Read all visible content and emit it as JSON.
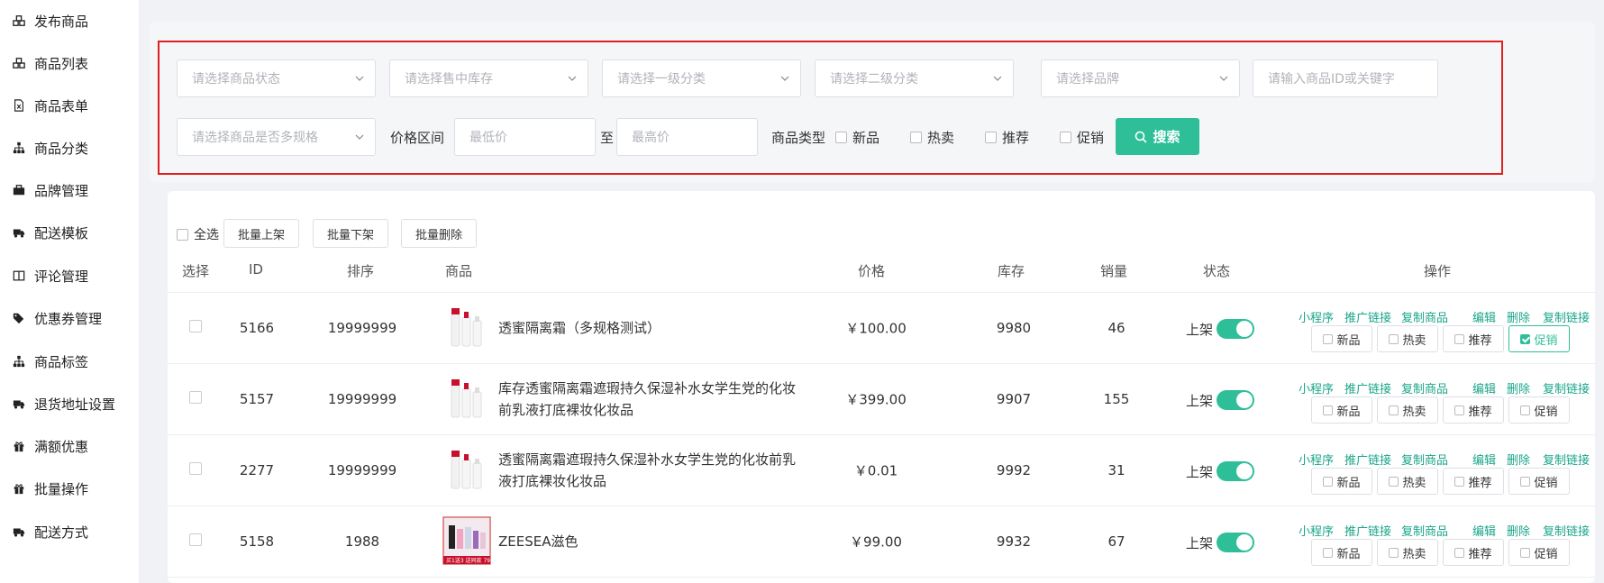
{
  "sidebar": {
    "items": [
      {
        "label": "发布商品",
        "icon": "cubes-icon"
      },
      {
        "label": "商品列表",
        "icon": "cubes-icon"
      },
      {
        "label": "商品表单",
        "icon": "excel-file-icon"
      },
      {
        "label": "商品分类",
        "icon": "sitemap-icon"
      },
      {
        "label": "品牌管理",
        "icon": "briefcase-icon"
      },
      {
        "label": "配送模板",
        "icon": "truck-icon"
      },
      {
        "label": "评论管理",
        "icon": "columns-icon"
      },
      {
        "label": "优惠券管理",
        "icon": "tags-icon"
      },
      {
        "label": "商品标签",
        "icon": "sitemap-icon"
      },
      {
        "label": "退货地址设置",
        "icon": "truck-icon"
      },
      {
        "label": "满额优惠",
        "icon": "gift-icon"
      },
      {
        "label": "批量操作",
        "icon": "gift-icon"
      },
      {
        "label": "配送方式",
        "icon": "truck-icon"
      }
    ]
  },
  "filters": {
    "status_placeholder": "请选择商品状态",
    "stock_placeholder": "请选择售中库存",
    "cat1_placeholder": "请选择一级分类",
    "cat2_placeholder": "请选择二级分类",
    "brand_placeholder": "请选择品牌",
    "keyword_placeholder": "请输入商品ID或关键字",
    "spec_placeholder": "请选择商品是否多规格",
    "price_label": "价格区间",
    "min_price_placeholder": "最低价",
    "to_label": "至",
    "max_price_placeholder": "最高价",
    "type_label": "商品类型",
    "types": [
      "新品",
      "热卖",
      "推荐",
      "促销"
    ],
    "search_label": "搜索"
  },
  "bulk": {
    "select_all": "全选",
    "on_shelf": "批量上架",
    "off_shelf": "批量下架",
    "delete": "批量删除"
  },
  "table": {
    "headers": {
      "select": "选择",
      "id": "ID",
      "sort": "排序",
      "product": "商品",
      "price": "价格",
      "stock": "库存",
      "sales": "销量",
      "status": "状态",
      "ops": "操作"
    },
    "rows": [
      {
        "id": "5166",
        "sort": "19999999",
        "name": "透蜜隔离霜（多规格测试）",
        "price": "￥100.00",
        "stock": "9980",
        "sales": "46",
        "status": "上架",
        "promo_on": true
      },
      {
        "id": "5157",
        "sort": "19999999",
        "name": "库存透蜜隔离霜遮瑕持久保湿补水女学生党的化妆前乳液打底裸妆化妆品",
        "price": "￥399.00",
        "stock": "9907",
        "sales": "155",
        "status": "上架",
        "promo_on": false
      },
      {
        "id": "2277",
        "sort": "19999999",
        "name": "透蜜隔离霜遮瑕持久保湿补水女学生党的化妆前乳液打底裸妆化妆品",
        "price": "￥0.01",
        "stock": "9992",
        "sales": "31",
        "status": "上架",
        "promo_on": false
      },
      {
        "id": "5158",
        "sort": "1988",
        "name": "ZEESEA滋色",
        "price": "￥99.00",
        "stock": "9932",
        "sales": "67",
        "status": "上架",
        "promo_on": false
      }
    ],
    "op_links": [
      "小程序",
      "推广链接",
      "复制商品",
      "编辑",
      "删除",
      "复制链接"
    ],
    "tag_buttons": [
      "新品",
      "热卖",
      "推荐",
      "促销"
    ],
    "thumb_caption": "买1送3 送同款 79"
  },
  "colors": {
    "accent": "#2ebf99",
    "link": "#1aa58a",
    "highlight_border": "#e02020"
  }
}
